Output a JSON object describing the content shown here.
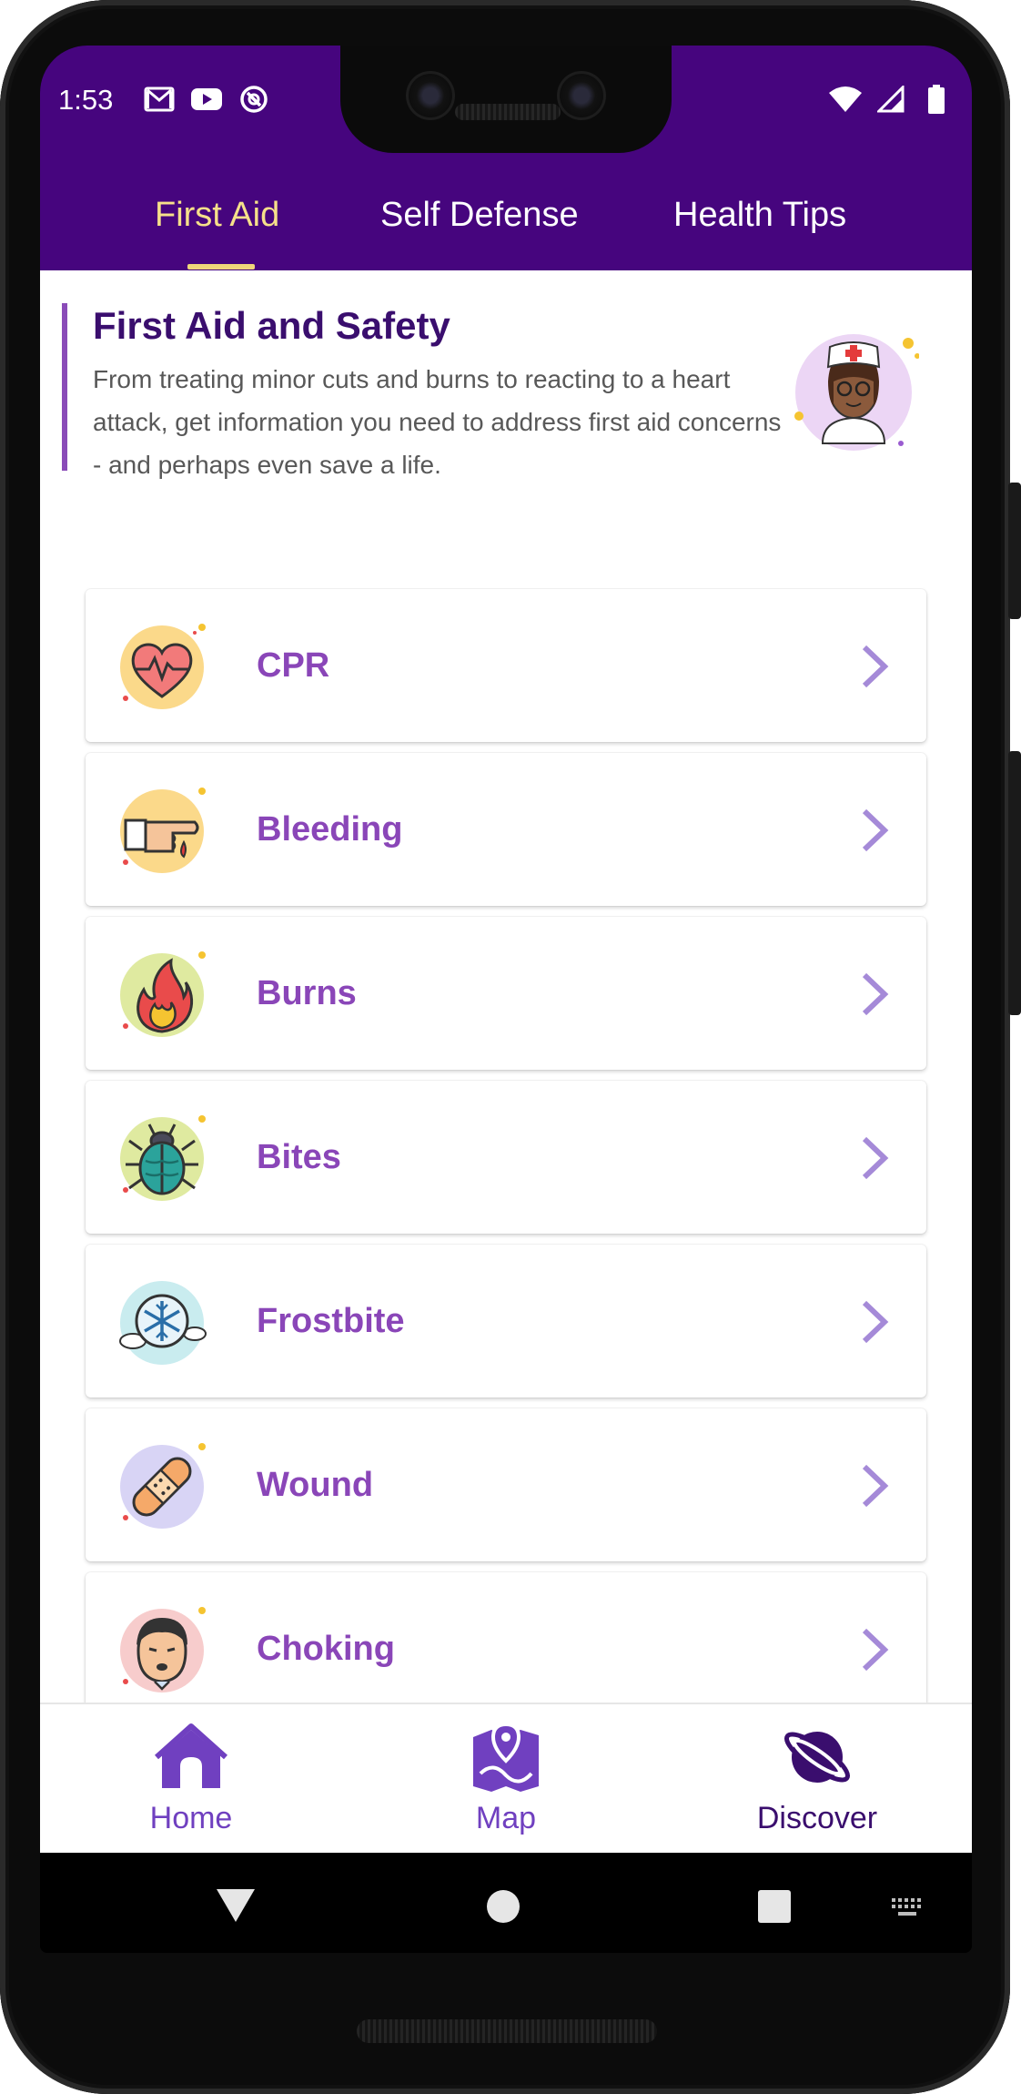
{
  "status_bar": {
    "time": "1:53",
    "left_icons": [
      "gmail-icon",
      "youtube-icon",
      "do-not-disturb-icon"
    ],
    "right_icons": [
      "wifi-icon",
      "cell-signal-icon",
      "battery-icon"
    ]
  },
  "tabs": [
    {
      "label": "First Aid",
      "active": true
    },
    {
      "label": "Self Defense",
      "active": false
    },
    {
      "label": "Health Tips",
      "active": false
    }
  ],
  "intro": {
    "title": "First Aid and Safety",
    "description": "From treating minor cuts and burns to reacting to a heart attack, get information you need to address first aid concerns - and perhaps even save a life.",
    "illustration": "nurse-icon"
  },
  "topics": [
    {
      "label": "CPR",
      "icon": "heart-pulse-icon"
    },
    {
      "label": "Bleeding",
      "icon": "bleeding-finger-icon"
    },
    {
      "label": "Burns",
      "icon": "flame-icon"
    },
    {
      "label": "Bites",
      "icon": "bug-icon"
    },
    {
      "label": "Frostbite",
      "icon": "snowflake-icon"
    },
    {
      "label": "Wound",
      "icon": "bandage-icon"
    },
    {
      "label": "Choking",
      "icon": "choking-face-icon"
    }
  ],
  "bottom_nav": [
    {
      "label": "Home",
      "icon": "home-icon",
      "active": false
    },
    {
      "label": "Map",
      "icon": "map-icon",
      "active": false
    },
    {
      "label": "Discover",
      "icon": "planet-icon",
      "active": true
    }
  ],
  "system_nav": [
    "back-icon",
    "home-circle-icon",
    "recents-icon",
    "keyboard-icon"
  ],
  "colors": {
    "header_bg": "#46057e",
    "active_tab": "#f6e08a",
    "card_label": "#8a46b8",
    "chevron": "#a58ad8",
    "nav_icon": "#7040c0",
    "nav_active": "#3a0e6e"
  }
}
